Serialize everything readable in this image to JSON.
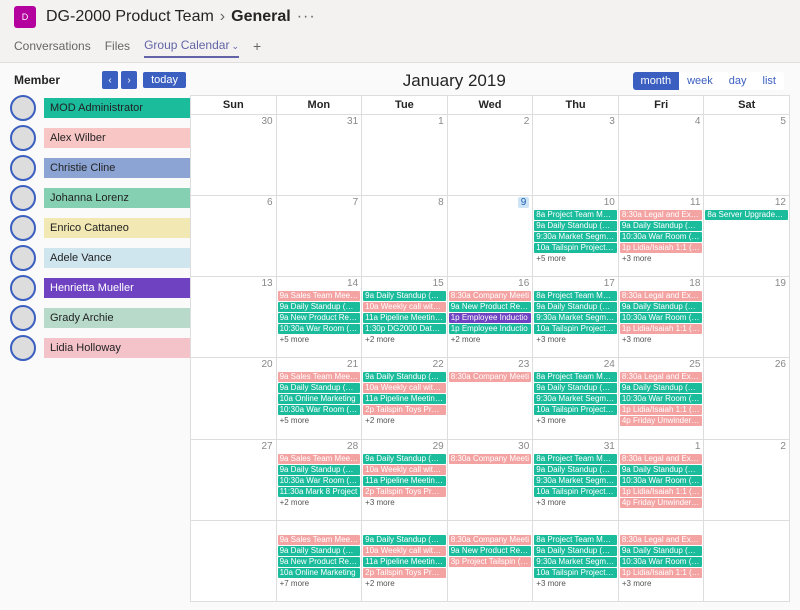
{
  "header": {
    "team_icon_text": "D",
    "team_name": "DG-2000 Product Team",
    "channel": "General",
    "ellipsis": "···"
  },
  "tabs": {
    "items": [
      "Conversations",
      "Files",
      "Group Calendar"
    ],
    "active_index": 2,
    "has_chevron_on_active": true,
    "add_label": "+"
  },
  "sidebar": {
    "title": "Member",
    "prev": "‹",
    "next": "›",
    "today": "today",
    "colors": [
      "#1abc9c",
      "#f9c6c6",
      "#8ba4d4",
      "#85d0b3",
      "#f2e8b3",
      "#cfe6ef",
      "#6f42c1",
      "#b7dacb",
      "#f4c2c9"
    ],
    "members": [
      "MOD Administrator",
      "Alex Wilber",
      "Christie Cline",
      "Johanna Lorenz",
      "Enrico Cattaneo",
      "Adele Vance",
      "Henrietta Mueller",
      "Grady Archie",
      "Lidia Holloway"
    ]
  },
  "calendar": {
    "title": "January 2019",
    "views": [
      "month",
      "week",
      "day",
      "list"
    ],
    "active_view": 0,
    "day_headers": [
      "Sun",
      "Mon",
      "Tue",
      "Wed",
      "Thu",
      "Fri",
      "Sat"
    ],
    "cells": [
      {
        "n": "30",
        "out": true
      },
      {
        "n": "31",
        "out": true
      },
      {
        "n": "1"
      },
      {
        "n": "2"
      },
      {
        "n": "3"
      },
      {
        "n": "4"
      },
      {
        "n": "5"
      },
      {
        "n": "6"
      },
      {
        "n": "7"
      },
      {
        "n": "8"
      },
      {
        "n": "9",
        "today": true
      },
      {
        "n": "10",
        "events": [
          {
            "t": "8a Project Team Meeti",
            "c": "teal"
          },
          {
            "t": "9a Daily Standup (MA)",
            "c": "teal"
          },
          {
            "t": "9:30a Market Segment",
            "c": "teal"
          },
          {
            "t": "10a Tailspin Project Di",
            "c": "teal"
          }
        ],
        "more": "+5 more"
      },
      {
        "n": "11",
        "events": [
          {
            "t": "8:30a Legal and Execu",
            "c": "pink"
          },
          {
            "t": "9a Daily Standup (MA)",
            "c": "teal"
          },
          {
            "t": "10:30a War Room (MA",
            "c": "teal"
          },
          {
            "t": "1p Lidia/Isaiah 1:1 (LH",
            "c": "pink"
          }
        ],
        "more": "+3 more"
      },
      {
        "n": "12",
        "events": [
          {
            "t": "8a Server Upgrades (M",
            "c": "teal"
          }
        ]
      },
      {
        "n": "13"
      },
      {
        "n": "14",
        "events": [
          {
            "t": "9a Sales Team Meeting",
            "c": "pink"
          },
          {
            "t": "9a Daily Standup (MA)",
            "c": "teal"
          },
          {
            "t": "9a New Product Regul",
            "c": "teal"
          },
          {
            "t": "10:30a War Room (MA",
            "c": "teal"
          }
        ],
        "more": "+5 more"
      },
      {
        "n": "15",
        "events": [
          {
            "t": "9a Daily Standup (MA)",
            "c": "teal"
          },
          {
            "t": "10a Weekly call with S",
            "c": "pink"
          },
          {
            "t": "11a Pipeline Meeting (",
            "c": "teal"
          },
          {
            "t": "1:30p DG2000 Data Sh",
            "c": "teal"
          }
        ],
        "more": "+2 more"
      },
      {
        "n": "16",
        "events": [
          {
            "t": "8:30a Company Meeti",
            "c": "pink"
          },
          {
            "t": "9a New Product Regul",
            "c": "teal"
          },
          {
            "t": "1p Employee Inductio",
            "c": "purple"
          },
          {
            "t": "1p Employee Inductio",
            "c": "teal"
          }
        ],
        "more": "+2 more"
      },
      {
        "n": "17",
        "events": [
          {
            "t": "8a Project Team Meeti",
            "c": "teal"
          },
          {
            "t": "9a Daily Standup (MA)",
            "c": "teal"
          },
          {
            "t": "9:30a Market Segment",
            "c": "teal"
          },
          {
            "t": "10a Tailspin Project Di",
            "c": "teal"
          }
        ],
        "more": "+3 more"
      },
      {
        "n": "18",
        "events": [
          {
            "t": "8:30a Legal and Execu",
            "c": "pink"
          },
          {
            "t": "9a Daily Standup (MA)",
            "c": "teal"
          },
          {
            "t": "10:30a War Room (MA",
            "c": "teal"
          },
          {
            "t": "1p Lidia/Isaiah 1:1 (LH",
            "c": "pink"
          }
        ],
        "more": "+3 more"
      },
      {
        "n": "19"
      },
      {
        "n": "20"
      },
      {
        "n": "21",
        "events": [
          {
            "t": "9a Sales Team Meeting",
            "c": "pink"
          },
          {
            "t": "9a Daily Standup (MA)",
            "c": "teal"
          },
          {
            "t": "10a Online Marketing",
            "c": "teal"
          },
          {
            "t": "10:30a War Room (MA",
            "c": "teal"
          }
        ],
        "more": "+5 more"
      },
      {
        "n": "22",
        "events": [
          {
            "t": "9a Daily Standup (MA)",
            "c": "teal"
          },
          {
            "t": "10a Weekly call with S",
            "c": "pink"
          },
          {
            "t": "11a Pipeline Meeting (",
            "c": "teal"
          },
          {
            "t": "2p Tailspin Toys Propo",
            "c": "pink"
          }
        ],
        "more": "+2 more"
      },
      {
        "n": "23",
        "events": [
          {
            "t": "8:30a Company Meeti",
            "c": "pink"
          }
        ]
      },
      {
        "n": "24",
        "events": [
          {
            "t": "8a Project Team Meeti",
            "c": "teal"
          },
          {
            "t": "9a Daily Standup (MA)",
            "c": "teal"
          },
          {
            "t": "9:30a Market Segment",
            "c": "teal"
          },
          {
            "t": "10a Tailspin Project Di",
            "c": "teal"
          }
        ],
        "more": "+3 more"
      },
      {
        "n": "25",
        "events": [
          {
            "t": "8:30a Legal and Execu",
            "c": "pink"
          },
          {
            "t": "9a Daily Standup (MA)",
            "c": "teal"
          },
          {
            "t": "10:30a War Room (MA",
            "c": "teal"
          },
          {
            "t": "1p Lidia/Isaiah 1:1 (LH",
            "c": "pink"
          },
          {
            "t": "4p Friday Unwinder (L",
            "c": "pink"
          }
        ]
      },
      {
        "n": "26"
      },
      {
        "n": "27"
      },
      {
        "n": "28",
        "events": [
          {
            "t": "9a Sales Team Meeting",
            "c": "pink"
          },
          {
            "t": "9a Daily Standup (MA)",
            "c": "teal"
          },
          {
            "t": "10:30a War Room (MA",
            "c": "teal"
          },
          {
            "t": "11:30a Mark 8 Project",
            "c": "teal"
          }
        ],
        "more": "+2 more"
      },
      {
        "n": "29",
        "events": [
          {
            "t": "9a Daily Standup (MA)",
            "c": "teal"
          },
          {
            "t": "10a Weekly call with S",
            "c": "pink"
          },
          {
            "t": "11a Pipeline Meeting (",
            "c": "teal"
          },
          {
            "t": "2p Tailspin Toys Propo",
            "c": "pink"
          }
        ],
        "more": "+3 more"
      },
      {
        "n": "30",
        "events": [
          {
            "t": "8:30a Company Meeti",
            "c": "pink"
          }
        ]
      },
      {
        "n": "31",
        "events": [
          {
            "t": "8a Project Team Meeti",
            "c": "teal"
          },
          {
            "t": "9a Daily Standup (MA)",
            "c": "teal"
          },
          {
            "t": "9:30a Market Segment",
            "c": "teal"
          },
          {
            "t": "10a Tailspin Project Di",
            "c": "teal"
          }
        ],
        "more": "+3 more"
      },
      {
        "n": "1",
        "out": true,
        "events": [
          {
            "t": "8:30a Legal and Execu",
            "c": "pink"
          },
          {
            "t": "9a Daily Standup (MA)",
            "c": "teal"
          },
          {
            "t": "10:30a War Room (MA",
            "c": "teal"
          },
          {
            "t": "1p Lidia/Isaiah 1:1 (LH",
            "c": "pink"
          },
          {
            "t": "4p Friday Unwinder (L",
            "c": "pink"
          }
        ]
      },
      {
        "n": "2",
        "out": true
      },
      {
        "n": ""
      },
      {
        "n": "",
        "events": [
          {
            "t": "9a Sales Team Meeting",
            "c": "pink"
          },
          {
            "t": "9a Daily Standup (MA)",
            "c": "teal"
          },
          {
            "t": "9a New Product Regul",
            "c": "teal"
          },
          {
            "t": "10a Online Marketing",
            "c": "teal"
          }
        ],
        "more": "+7 more"
      },
      {
        "n": "",
        "events": [
          {
            "t": "9a Daily Standup (MA)",
            "c": "teal"
          },
          {
            "t": "10a Weekly call with S",
            "c": "pink"
          },
          {
            "t": "11a Pipeline Meeting (",
            "c": "teal"
          },
          {
            "t": "2p Tailspin Toys Propo",
            "c": "pink"
          }
        ],
        "more": "+2 more"
      },
      {
        "n": "",
        "events": [
          {
            "t": "8:30a Company Meeti",
            "c": "pink"
          },
          {
            "t": "9a New Product Regul",
            "c": "teal"
          },
          {
            "t": "3p Project Tailspin (LH",
            "c": "pink"
          }
        ]
      },
      {
        "n": "",
        "events": [
          {
            "t": "8a Project Team Meeti",
            "c": "teal"
          },
          {
            "t": "9a Daily Standup (MA)",
            "c": "teal"
          },
          {
            "t": "9:30a Market Segment",
            "c": "teal"
          },
          {
            "t": "10a Tailspin Project Di",
            "c": "teal"
          }
        ],
        "more": "+3 more"
      },
      {
        "n": "",
        "events": [
          {
            "t": "8:30a Legal and Execu",
            "c": "pink"
          },
          {
            "t": "9a Daily Standup (MA)",
            "c": "teal"
          },
          {
            "t": "10:30a War Room (MA",
            "c": "teal"
          },
          {
            "t": "1p Lidia/Isaiah 1:1 (LH",
            "c": "pink"
          }
        ],
        "more": "+3 more"
      },
      {
        "n": ""
      }
    ]
  }
}
